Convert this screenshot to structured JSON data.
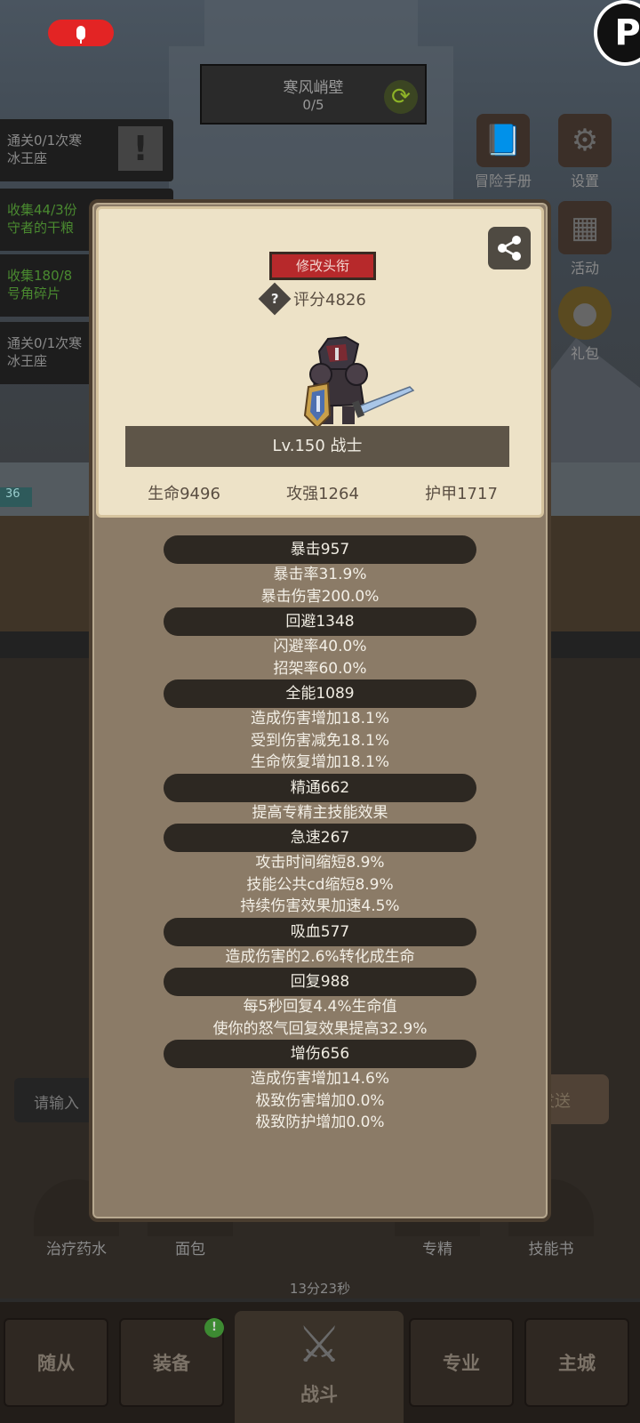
{
  "stage": {
    "name": "寒风峭壁",
    "progress": "0/5"
  },
  "corner_logo": "P",
  "quests": [
    {
      "line1": "通关0/1次寒",
      "line2": "冰王座"
    },
    {
      "line1": "收集44/3份",
      "line2": "守者的干粮"
    },
    {
      "line1": "收集180/8",
      "line2": "号角碎片"
    },
    {
      "line1": "通关0/1次寒",
      "line2": "冰王座"
    }
  ],
  "side_menu": [
    {
      "label": "冒险手册",
      "icon": "book-icon"
    },
    {
      "label": "设置",
      "icon": "gear-icon"
    },
    {
      "label": "活动",
      "icon": "calendar-icon"
    },
    {
      "label": "礼包",
      "icon": "coin-icon"
    }
  ],
  "level_tag": "36",
  "popup": {
    "title_button": "修改头衔",
    "score": "评分4826",
    "level_class": "Lv.150 战士",
    "base_stats": [
      "生命9496",
      "攻强1264",
      "护甲1717"
    ],
    "groups": [
      {
        "title": "暴击957",
        "lines": [
          "暴击率31.9%",
          "暴击伤害200.0%"
        ]
      },
      {
        "title": "回避1348",
        "lines": [
          "闪避率40.0%",
          "招架率60.0%"
        ]
      },
      {
        "title": "全能1089",
        "lines": [
          "造成伤害增加18.1%",
          "受到伤害减免18.1%",
          "生命恢复增加18.1%"
        ]
      },
      {
        "title": "精通662",
        "lines": [
          "提高专精主技能效果"
        ]
      },
      {
        "title": "急速267",
        "lines": [
          "攻击时间缩短8.9%",
          "技能公共cd缩短8.9%",
          "持续伤害效果加速4.5%"
        ]
      },
      {
        "title": "吸血577",
        "lines": [
          "造成伤害的2.6%转化成生命"
        ]
      },
      {
        "title": "回复988",
        "lines": [
          "每5秒回复4.4%生命值",
          "使你的怒气回复效果提高32.9%"
        ]
      },
      {
        "title": "增伤656",
        "lines": [
          "造成伤害增加14.6%",
          "极致伤害增加0.0%",
          "极致防护增加0.0%"
        ]
      }
    ]
  },
  "chat": {
    "placeholder": "请输入",
    "send": "发送"
  },
  "items": [
    "治疗药水",
    "面包",
    "",
    "专精",
    "技能书"
  ],
  "timer": "13分23秒",
  "nav": {
    "followers": "随从",
    "equipment": "装备",
    "battle": "战斗",
    "profession": "专业",
    "main_city": "主城",
    "badge": "!"
  },
  "colors": {
    "panel": "#8b7b67",
    "card": "#ede2c7",
    "title_button": "#b7292b",
    "stat_header": "#2d2822"
  }
}
